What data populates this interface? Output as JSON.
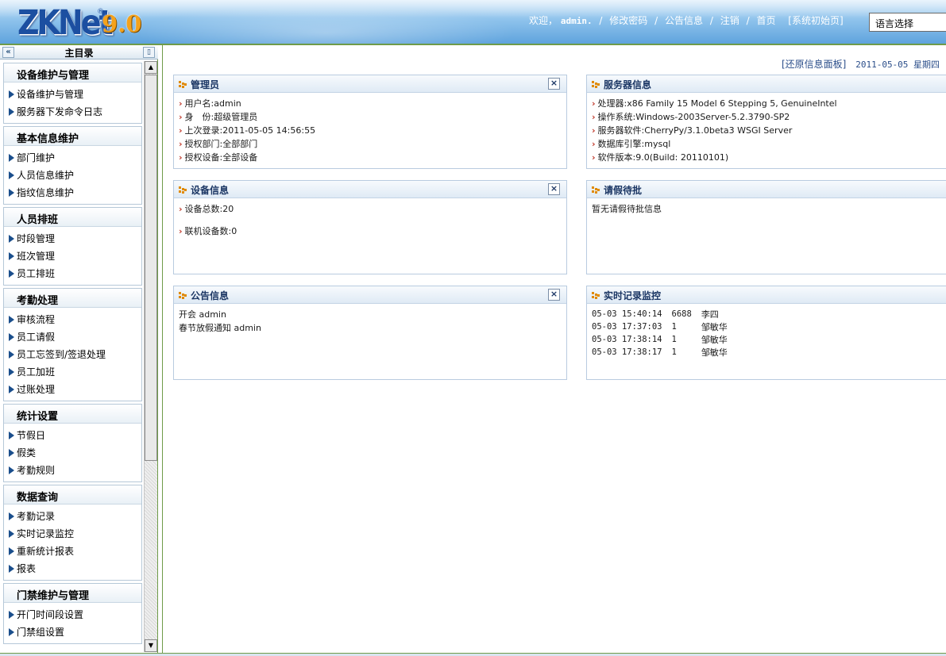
{
  "header": {
    "logo_main": "ZKNet",
    "logo_reg": "®",
    "logo_version": "9.0",
    "welcome": "欢迎，",
    "username": "admin.",
    "sep": "/",
    "change_password": "修改密码",
    "announcements": "公告信息",
    "logout": "注销",
    "home": "首页",
    "init_page": "[系统初始页]",
    "language_select": "语言选择"
  },
  "sidebar": {
    "title": "主目录",
    "collapse_glyph": "«",
    "pin_glyph": "▯",
    "groups": [
      {
        "title": "设备维护与管理",
        "items": [
          "设备维护与管理",
          "服务器下发命令日志"
        ]
      },
      {
        "title": "基本信息维护",
        "items": [
          "部门维护",
          "人员信息维护",
          "指纹信息维护"
        ]
      },
      {
        "title": "人员排班",
        "items": [
          "时段管理",
          "班次管理",
          "员工排班"
        ]
      },
      {
        "title": "考勤处理",
        "items": [
          "审核流程",
          "员工请假",
          "员工忘签到/签退处理",
          "员工加班",
          "过账处理"
        ]
      },
      {
        "title": "统计设置",
        "items": [
          "节假日",
          "假类",
          "考勤规则"
        ]
      },
      {
        "title": "数据查询",
        "items": [
          "考勤记录",
          "实时记录监控",
          "重新统计报表",
          "报表"
        ]
      },
      {
        "title": "门禁维护与管理",
        "items": [
          "开门时间段设置",
          "门禁组设置"
        ]
      }
    ]
  },
  "main": {
    "restore_panels": "[还原信息面板]",
    "date": "2011-05-05 星期四",
    "panels": {
      "admin": {
        "title": "管理员",
        "close": "×",
        "rows": [
          "用户名:admin",
          "身　份:超级管理员",
          "上次登录:2011-05-05 14:56:55",
          "授权部门:全部部门",
          "授权设备:全部设备"
        ]
      },
      "server": {
        "title": "服务器信息",
        "rows": [
          "处理器:x86 Family 15 Model 6 Stepping 5, GenuineIntel",
          "操作系统:Windows-2003Server-5.2.3790-SP2",
          "服务器软件:CherryPy/3.1.0beta3 WSGI Server",
          "数据库引擎:mysql",
          "软件版本:9.0(Build: 20110101)"
        ]
      },
      "device": {
        "title": "设备信息",
        "close": "×",
        "rows": [
          "设备总数:20",
          "联机设备数:0"
        ]
      },
      "leave": {
        "title": "请假待批",
        "text": "暂无请假待批信息"
      },
      "notice": {
        "title": "公告信息",
        "close": "×",
        "rows": [
          "开会 admin",
          "春节放假通知 admin"
        ]
      },
      "realtime": {
        "title": "实时记录监控",
        "records": [
          {
            "time": "05-03 15:40:14",
            "pin": "6688",
            "name": "李四"
          },
          {
            "time": "05-03 17:37:03",
            "pin": "1",
            "name": "邹敏华"
          },
          {
            "time": "05-03 17:38:14",
            "pin": "1",
            "name": "邹敏华"
          },
          {
            "time": "05-03 17:38:17",
            "pin": "1",
            "name": "邹敏华"
          }
        ]
      }
    }
  },
  "colors": {
    "header_blue": "#5fa3dd",
    "border_green": "#6f9b49",
    "arrow_red": "#c0392b",
    "panel_title": "#1b3664"
  }
}
